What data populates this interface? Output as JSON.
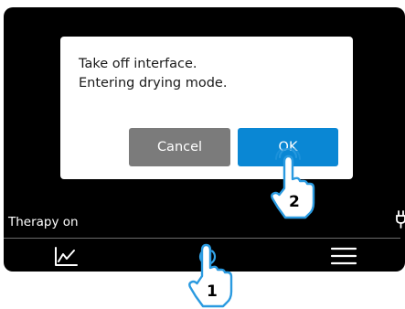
{
  "dialog": {
    "message_line1": "Take off interface.",
    "message_line2": "Entering drying mode.",
    "cancel_label": "Cancel",
    "ok_label": "OK"
  },
  "status": {
    "text": "Therapy on"
  },
  "nav": {
    "icons": [
      "chart-icon",
      "power-icon",
      "menu-icon"
    ]
  },
  "annotations": {
    "step1": "1",
    "step2": "2"
  },
  "colors": {
    "ok_button": "#0a87d4",
    "cancel_button": "#7b7b7b",
    "screen_background": "#000000",
    "power_glow": "#35a4e8"
  }
}
